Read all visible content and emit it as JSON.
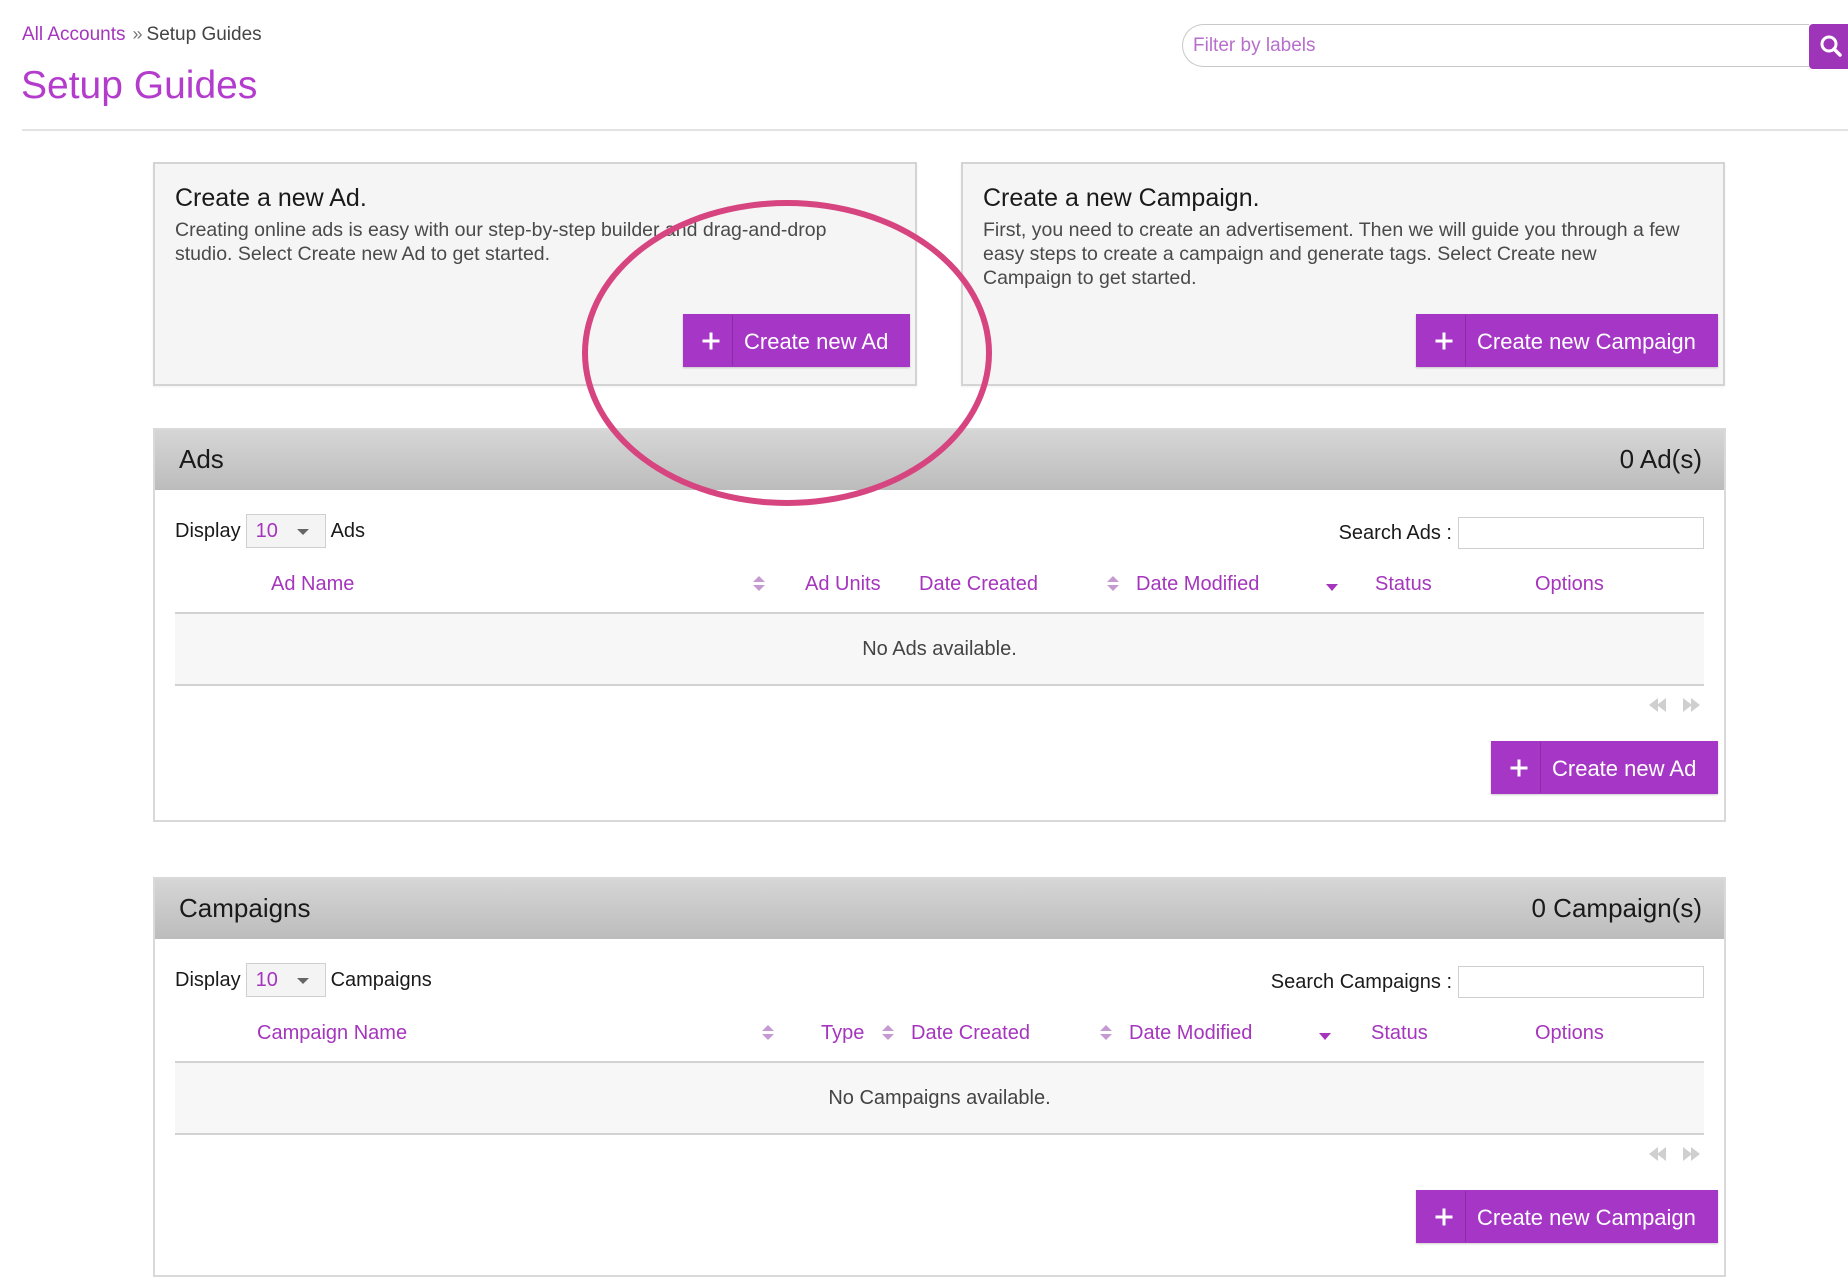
{
  "breadcrumb": {
    "root": "All Accounts",
    "separator": "»",
    "current": "Setup Guides"
  },
  "page_title": "Setup Guides",
  "filter": {
    "placeholder": "Filter by labels",
    "icon": "search-icon"
  },
  "cards": {
    "ad": {
      "title": "Create a new Ad.",
      "description": "Creating online ads is easy with our step-by-step builder and drag-and-drop studio. Select Create new Ad to get started.",
      "button_label": "Create new Ad"
    },
    "campaign": {
      "title": "Create a new Campaign.",
      "description": "First, you need to create an advertisement. Then we will guide you through a few easy steps to create a campaign and generate tags. Select Create new Campaign to get started.",
      "button_label": "Create new Campaign"
    }
  },
  "ads_panel": {
    "title": "Ads",
    "count": "0 Ad(s)",
    "display_label": "Display",
    "display_value": "10",
    "display_suffix": "Ads",
    "search_label": "Search Ads :",
    "columns": [
      "Ad Name",
      "Ad Units",
      "Date Created",
      "Date Modified",
      "Status",
      "Options"
    ],
    "empty_message": "No Ads available.",
    "button_label": "Create new Ad"
  },
  "campaigns_panel": {
    "title": "Campaigns",
    "count": "0 Campaign(s)",
    "display_label": "Display",
    "display_value": "10",
    "display_suffix": "Campaigns",
    "search_label": "Search Campaigns :",
    "columns": [
      "Campaign Name",
      "Type",
      "Date Created",
      "Date Modified",
      "Status",
      "Options"
    ],
    "empty_message": "No Campaigns available.",
    "button_label": "Create new Campaign"
  },
  "colors": {
    "accent": "#a637c6",
    "title": "#b43ccd",
    "highlight_ring": "#d6457f"
  }
}
